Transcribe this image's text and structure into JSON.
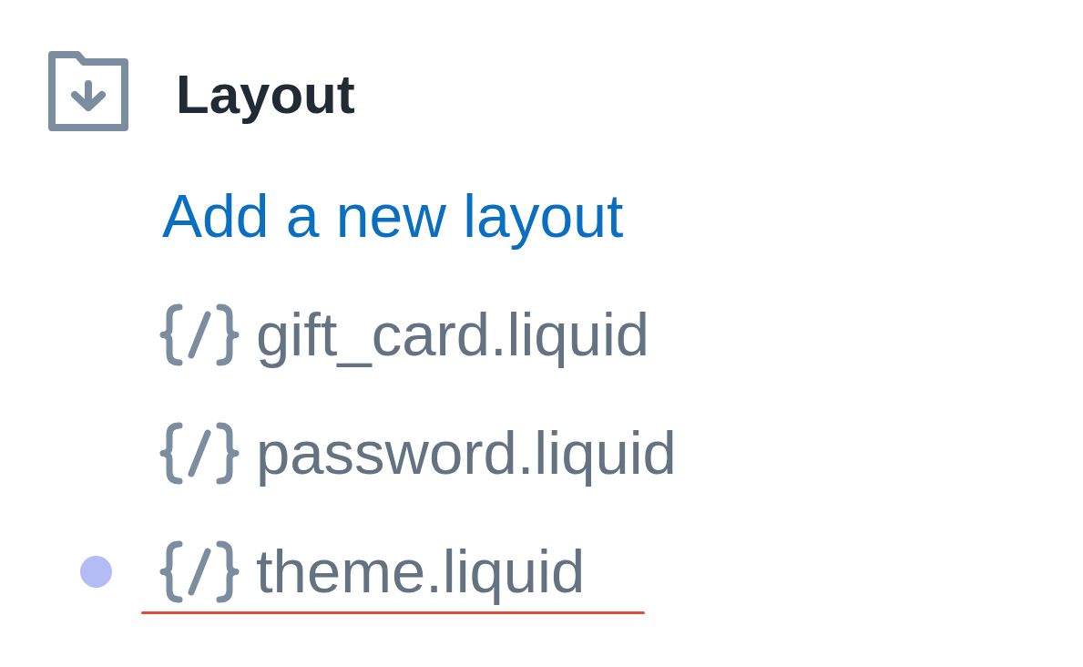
{
  "section": {
    "title": "Layout",
    "add_link": "Add a new layout",
    "files": [
      {
        "name": "gift_card.liquid",
        "modified": false,
        "underlined": false
      },
      {
        "name": "password.liquid",
        "modified": false,
        "underlined": false
      },
      {
        "name": "theme.liquid",
        "modified": true,
        "underlined": true
      }
    ]
  }
}
